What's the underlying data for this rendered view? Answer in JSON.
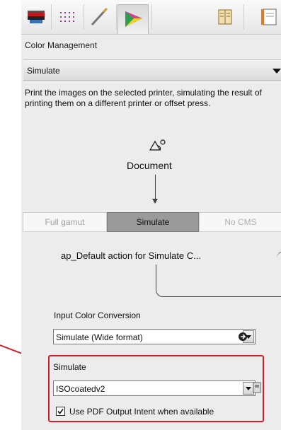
{
  "toolbar": {
    "icons": [
      "printer-icon",
      "grid-icon",
      "pen-icon",
      "color-wheel-icon",
      "book-icon",
      "page-icon"
    ]
  },
  "color_management": {
    "section_label": "Color Management",
    "mode_value": "Simulate",
    "description": "Print the images on the selected printer, simulating the result of printing them on a different printer or offset press."
  },
  "document": {
    "label": "Document"
  },
  "segments": {
    "full_gamut": "Full gamut",
    "simulate": "Simulate",
    "no_cms": "No CMS"
  },
  "action": {
    "label": "ap_Default action for Simulate C..."
  },
  "input_conversion": {
    "label": "Input Color Conversion",
    "value": "Simulate (Wide format)"
  },
  "simulate_group": {
    "label": "Simulate",
    "profile_value": "ISOcoatedv2",
    "checkbox_label": "Use PDF Output Intent when available",
    "checkbox_checked": true
  },
  "colors": {
    "highlight": "#d0202c",
    "selected_segment": "#9a9a9a"
  }
}
